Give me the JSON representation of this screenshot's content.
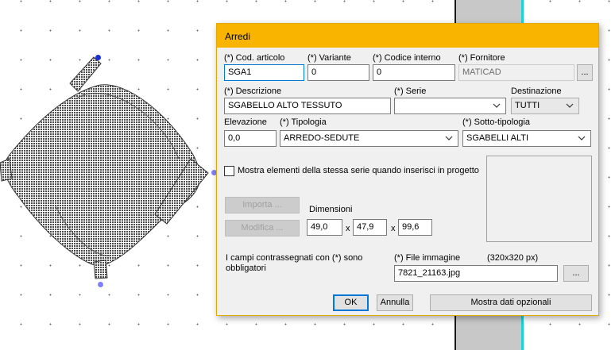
{
  "dialog": {
    "title": "Arredi",
    "cod_articolo": {
      "label": "(*) Cod. articolo",
      "value": "SGA1"
    },
    "variante": {
      "label": "(*) Variante",
      "value": "0"
    },
    "codice_interno": {
      "label": "(*) Codice interno",
      "value": "0"
    },
    "fornitore": {
      "label": "(*) Fornitore",
      "value": "MATICAD",
      "browse_label": "..."
    },
    "descrizione": {
      "label": "(*) Descrizione",
      "value": "SGABELLO ALTO TESSUTO"
    },
    "serie": {
      "label": "(*) Serie",
      "value": ""
    },
    "destinazione": {
      "label": "Destinazione",
      "value": "TUTTI"
    },
    "elevazione": {
      "label": "Elevazione",
      "value": "0,0"
    },
    "tipologia": {
      "label": "(*) Tipologia",
      "value": "ARREDO-SEDUTE"
    },
    "sotto_tipologia": {
      "label": "(*) Sotto-tipologia",
      "value": "SGABELLI ALTI"
    },
    "mostra_serie": {
      "label": "Mostra elementi della stessa serie quando inserisci in progetto",
      "checked": false
    },
    "importa_label": "Importa ...",
    "modifica_label": "Modifica ...",
    "dimensioni": {
      "label": "Dimensioni",
      "x": "49,0",
      "y": "47,9",
      "z": "99,6",
      "sep": "x"
    },
    "note": "I campi contrassegnati con (*) sono obbligatori",
    "file_immagine": {
      "label": "(*) File immagine",
      "size_hint": "(320x320 px)",
      "value": "7821_21163.jpg",
      "browse_label": "..."
    },
    "ok_label": "OK",
    "annulla_label": "Annulla",
    "mostra_dati_label": "Mostra dati opzionali"
  },
  "colors": {
    "titlebar": "#f9b400",
    "handle_selected": "#1a2fd6",
    "handle_other": "#8080ff",
    "wall_accent": "#1fd3d3"
  },
  "icons": {
    "chevron": "chevron-down-icon",
    "handle": "grip-handle-icon"
  }
}
